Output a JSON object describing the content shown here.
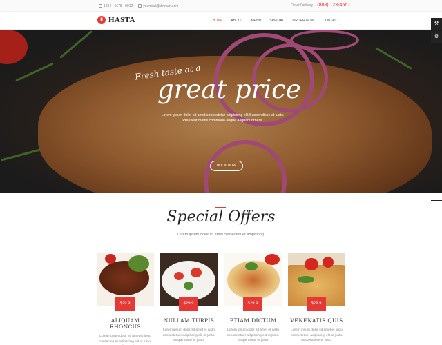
{
  "topbar": {
    "phone": "1234 - 5678 - 9012",
    "email": "yourmail@domain.com",
    "order_label": "Order Delivery",
    "order_phone": "(888) 123-4567"
  },
  "header": {
    "logo_text": "HASTA",
    "nav": [
      {
        "label": "HOME",
        "active": true
      },
      {
        "label": "ABOUT",
        "active": false
      },
      {
        "label": "MENU",
        "active": false
      },
      {
        "label": "SPECIAL",
        "active": false
      },
      {
        "label": "ORDER NOW",
        "active": false
      },
      {
        "label": "CONTACT",
        "active": false
      }
    ]
  },
  "hero": {
    "tagline_small": "Fresh taste at a",
    "tagline_big": "great price",
    "lead": "Lorem ipsum dolor sit amet consectetur adipiscing elit Suspendisse et justo. Praesent mattis commodo augue Aliquam ornare.",
    "button": "BOOK NOW"
  },
  "offers": {
    "title": "Special Offers",
    "subtitle": "Lorem ipsum dolor sit amet consectetuer adipiscing.",
    "items": [
      {
        "name": "ALIQUAM RHONCUS",
        "price": "$29.9",
        "desc": "Lorem ipsum dolor sit amet et justo consectetuer adipiscing elit ut justo. Suspendisse et justo."
      },
      {
        "name": "NULLAM TURPIS",
        "price": "$29.9",
        "desc": "Lorem ipsum dolor sit amet et justo consectetuer adipiscing elit ut justo. Suspendisse et justo."
      },
      {
        "name": "ETIAM DICTUM",
        "price": "$29.9",
        "desc": "Lorem ipsum dolor sit amet et justo consectetuer adipiscing elit ut justo. Suspendisse et justo."
      },
      {
        "name": "VENENATIS QUIS",
        "price": "$29.9",
        "desc": "Lorem ipsum dolor sit amet et justo consectetuer adipiscing elit ut justo. Suspendisse et justo."
      }
    ]
  },
  "colors": {
    "accent": "#e53935",
    "dark": "#222222"
  },
  "icons": [
    "phone-icon",
    "mail-icon",
    "wrench-icon",
    "gear-icon",
    "logo-icon"
  ]
}
